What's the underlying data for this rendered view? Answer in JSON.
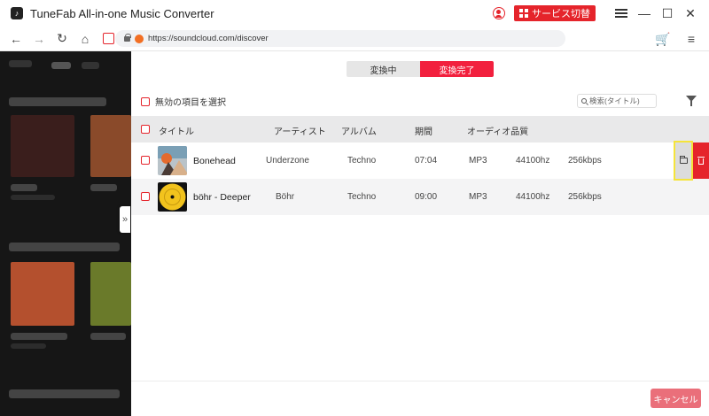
{
  "app": {
    "title": "TuneFab All-in-one Music Converter",
    "logo_glyph": "♪"
  },
  "titlebar": {
    "switch_service_label": "サービス切替",
    "icons": [
      "user-icon",
      "menu-icon",
      "minimize-icon",
      "maximize-icon",
      "close-icon"
    ]
  },
  "browser": {
    "url": "https://soundcloud.com/discover"
  },
  "tabs": {
    "converting": "変換中",
    "completed": "変換完了",
    "active": "completed"
  },
  "toolbar": {
    "select_invalid_label": "無効の項目を選択",
    "search_placeholder": "検索(タイトル)"
  },
  "table": {
    "columns": {
      "title": "タイトル",
      "artist": "アーティスト",
      "album": "アルバム",
      "duration": "期間",
      "audio_quality": "オーディオ品質"
    },
    "rows": [
      {
        "title": "Bonehead",
        "artist": "Underzone",
        "album": "Techno",
        "duration": "07:04",
        "format": "MP3",
        "sample_rate": "44100hz",
        "bitrate": "256kbps"
      },
      {
        "title": "böhr - Deeper",
        "artist": "Böhr",
        "album": "Techno",
        "duration": "09:00",
        "format": "MP3",
        "sample_rate": "44100hz",
        "bitrate": "256kbps"
      }
    ]
  },
  "footer": {
    "cancel_label": "キャンセル"
  },
  "colors": {
    "accent": "#e5242b",
    "tab_active": "#f2203e",
    "highlight": "#f5e43a"
  }
}
